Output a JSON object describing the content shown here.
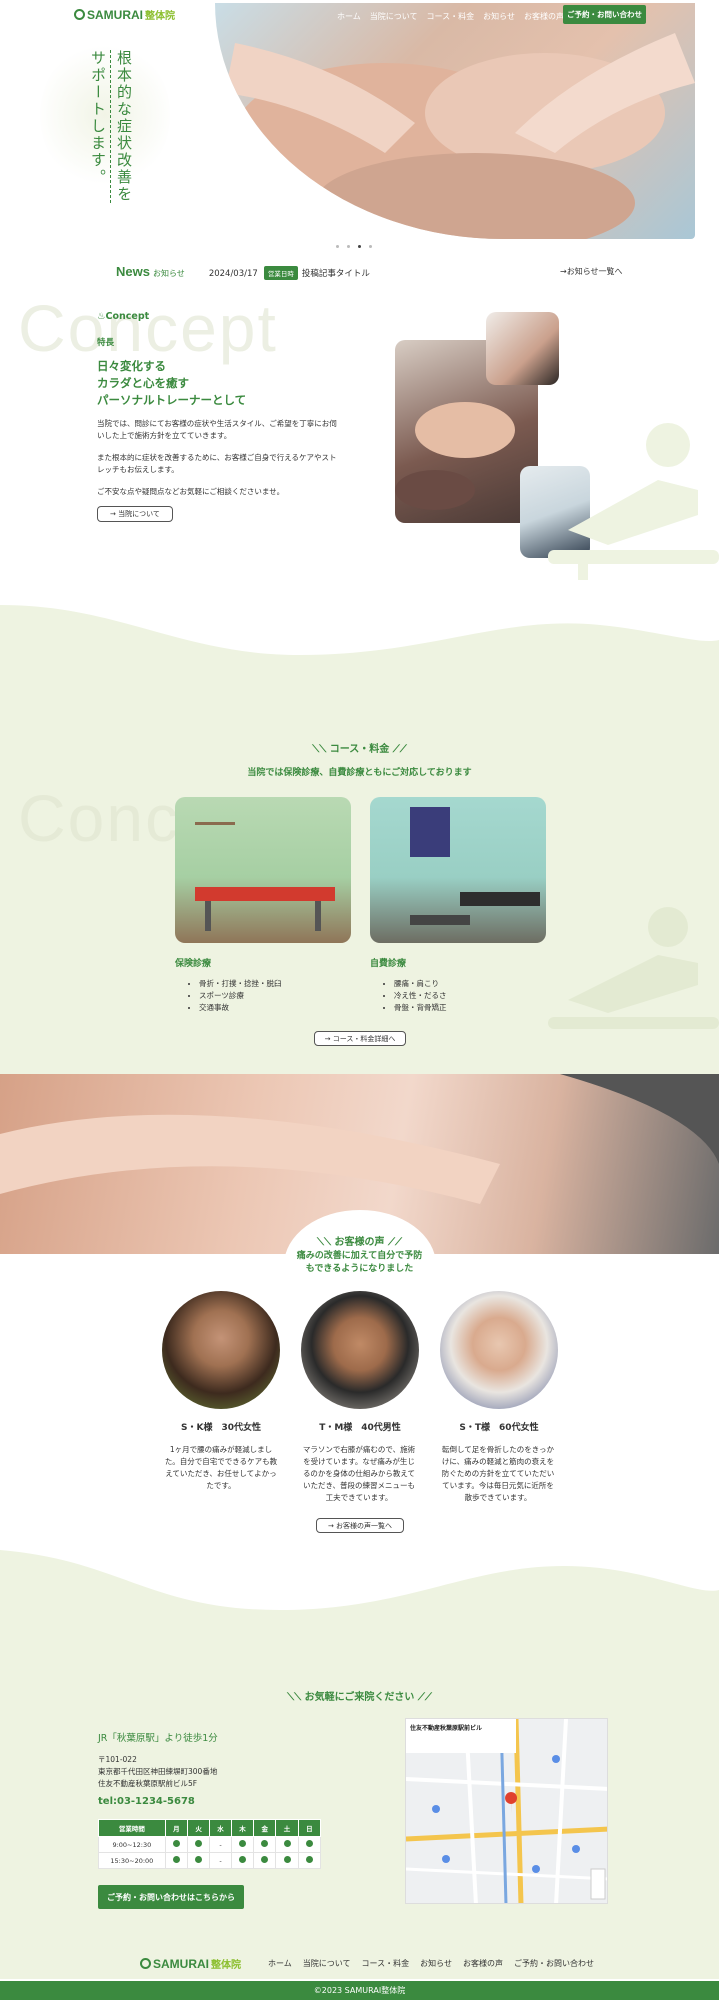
{
  "header": {
    "logo_text": "SAMURAI",
    "logo_jp": "整体院",
    "nav": [
      "ホーム",
      "当院について",
      "コース・料金",
      "お知らせ",
      "お客様の声"
    ],
    "cta": "ご予約・お問い合わせ"
  },
  "hero": {
    "tagline_col1": "根本的な症状改善を",
    "tagline_col2": "サポートします。",
    "dots": 4,
    "active_dot": 3
  },
  "news": {
    "title_en": "News",
    "title_jp": "お知らせ",
    "date": "2024/03/17",
    "badge": "営業日時",
    "post_title": "投稿記事タイトル",
    "more": "→お知らせ一覧へ"
  },
  "concept": {
    "ghost": "Concept",
    "label": "Concept",
    "sub": "特長",
    "heading": [
      "日々変化する",
      "カラダと心を癒す",
      "パーソナルトレーナーとして"
    ],
    "p1": "当院では、問診にてお客様の症状や生活スタイル、ご希望を丁寧にお伺いした上で施術方針を立てていきます。",
    "p2": "また根本的に症状を改善するために、お客様ご自身で行えるケアやストレッチもお伝えします。",
    "p3": "ご不安な点や疑問点などお気軽にご相談くださいませ。",
    "button": "→ 当院について"
  },
  "course": {
    "ghost": "Concept",
    "title": "コース・料金",
    "sub": "当院では保険診療、自費診療ともにご対応しております",
    "items": [
      {
        "name": "保険診療",
        "list": [
          "骨折・打撲・捻挫・脱臼",
          "スポーツ診療",
          "交通事故"
        ]
      },
      {
        "name": "自費診療",
        "list": [
          "腰痛・肩こり",
          "冷え性・だるさ",
          "骨盤・背骨矯正"
        ]
      }
    ],
    "button": "→ コース・料金詳細へ"
  },
  "voice": {
    "title": "お客様の声",
    "sub1": "痛みの改善に加えて自分で予防",
    "sub2": "もできるようになりました",
    "items": [
      {
        "name": "S・K様　30代女性",
        "text": "1ヶ月で腰の痛みが軽減しました。自分で自宅でできるケアも教えていただき、お任せしてよかったです。"
      },
      {
        "name": "T・M様　40代男性",
        "text": "マラソンで右膝が痛むので、施術を受けています。なぜ痛みが生じるのかを身体の仕組みから教えていただき、普段の練習メニューも工夫できています。"
      },
      {
        "name": "S・T様　60代女性",
        "text": "転倒して足を骨折したのをきっかけに、痛みの軽減と筋肉の衰えを防ぐための方針を立てていただいています。今は毎日元気に近所を散歩できています。"
      }
    ],
    "button": "→ お客様の声一覧へ"
  },
  "access": {
    "title": "お気軽にご来院ください",
    "station": "JR「秋葉原駅」より徒歩1分",
    "zip": "〒101-022",
    "addr1": "東京都千代田区神田練塀町300番地",
    "addr2": "住友不動産秋葉原駅前ビル5F",
    "tel": "tel:03-1234-5678",
    "hours_head": [
      "営業時間",
      "月",
      "火",
      "水",
      "木",
      "金",
      "土",
      "日"
    ],
    "hours_rows": [
      {
        "time": "9:00~12:30",
        "marks": [
          "●",
          "●",
          "-",
          "●",
          "●",
          "●",
          "●"
        ]
      },
      {
        "time": "15:30~20:00",
        "marks": [
          "●",
          "●",
          "-",
          "●",
          "●",
          "●",
          "●"
        ]
      }
    ],
    "cta": "ご予約・お問い合わせはこちらから",
    "map_label": "住友不動産秋葉原駅前ビル"
  },
  "footer": {
    "logo_text": "SAMURAI",
    "logo_jp": "整体院",
    "nav": [
      "ホーム",
      "当院について",
      "コース・料金",
      "お知らせ",
      "お客様の声",
      "ご予約・お問い合わせ"
    ],
    "copyright": "©2023 SAMURAI整体院"
  },
  "colors": {
    "brand": "#3b8a3f",
    "light_bg": "#eef3e1"
  }
}
